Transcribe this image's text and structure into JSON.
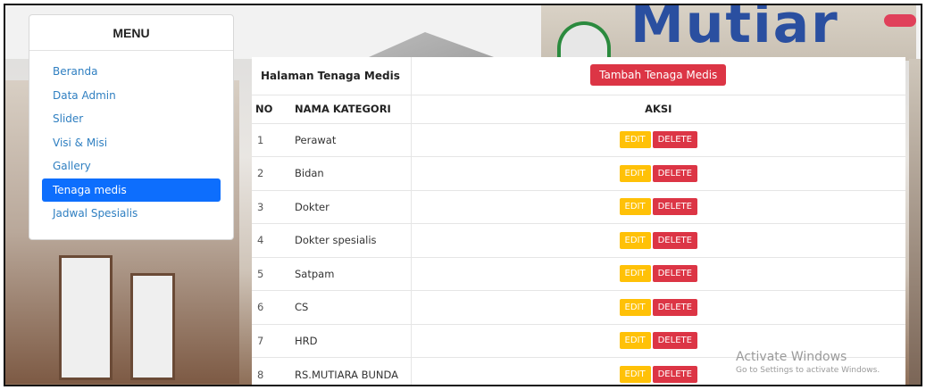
{
  "menu": {
    "title": "MENU",
    "items": [
      {
        "label": "Beranda",
        "active": false
      },
      {
        "label": "Data Admin",
        "active": false
      },
      {
        "label": "Slider",
        "active": false
      },
      {
        "label": "Visi & Misi",
        "active": false
      },
      {
        "label": "Gallery",
        "active": false
      },
      {
        "label": "Tenaga medis",
        "active": true
      },
      {
        "label": "Jadwal Spesialis",
        "active": false
      }
    ]
  },
  "page": {
    "title": "Halaman Tenaga Medis",
    "add_button": "Tambah Tenaga Medis"
  },
  "table": {
    "headers": {
      "no": "NO",
      "name": "NAMA KATEGORI",
      "actions": "AKSI"
    },
    "edit_label": "EDIT",
    "delete_label": "DELETE",
    "rows": [
      {
        "no": "1",
        "name": "Perawat"
      },
      {
        "no": "2",
        "name": "Bidan"
      },
      {
        "no": "3",
        "name": "Dokter"
      },
      {
        "no": "4",
        "name": "Dokter spesialis"
      },
      {
        "no": "5",
        "name": "Satpam"
      },
      {
        "no": "6",
        "name": "CS"
      },
      {
        "no": "7",
        "name": "HRD"
      },
      {
        "no": "8",
        "name": "RS.MUTIARA BUNDA"
      }
    ]
  },
  "background": {
    "sign_text": "Mutiar"
  },
  "watermark": {
    "line1": "Activate Windows",
    "line2": "Go to Settings to activate Windows."
  },
  "colors": {
    "primary": "#0d6efd",
    "danger": "#dc3545",
    "warning": "#ffc107",
    "link": "#2f7fc1"
  }
}
